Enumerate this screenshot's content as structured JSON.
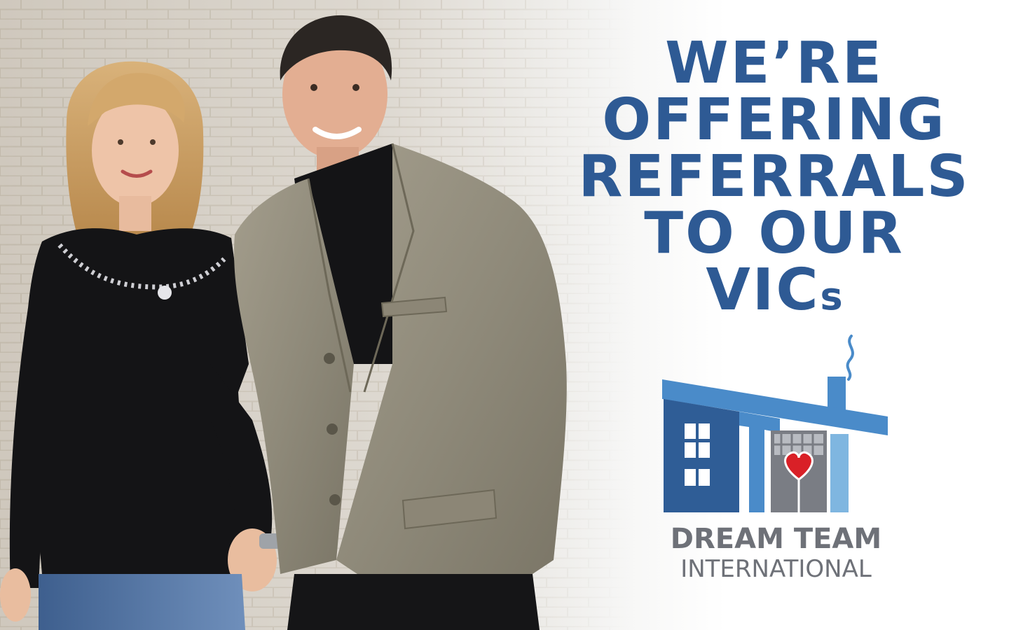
{
  "headline": {
    "line1": "WE’RE",
    "line2": "OFFERING",
    "line3": "REFERRALS",
    "line4": "TO OUR",
    "line5_main": "VIC",
    "line5_suffix": "s"
  },
  "logo": {
    "line1": "DREAM TEAM",
    "line2": "INTERNATIONAL",
    "icon": "house-with-heart-logo-icon"
  },
  "photo": {
    "icon": "two-person-portrait-photo"
  },
  "colors": {
    "headline_blue": "#2e5a94",
    "logo_dark_blue": "#2f5d96",
    "logo_mid_blue": "#4a8bc9",
    "logo_light_blue": "#7fb6e0",
    "logo_gray": "#6e7178",
    "heart_red": "#d92027"
  }
}
